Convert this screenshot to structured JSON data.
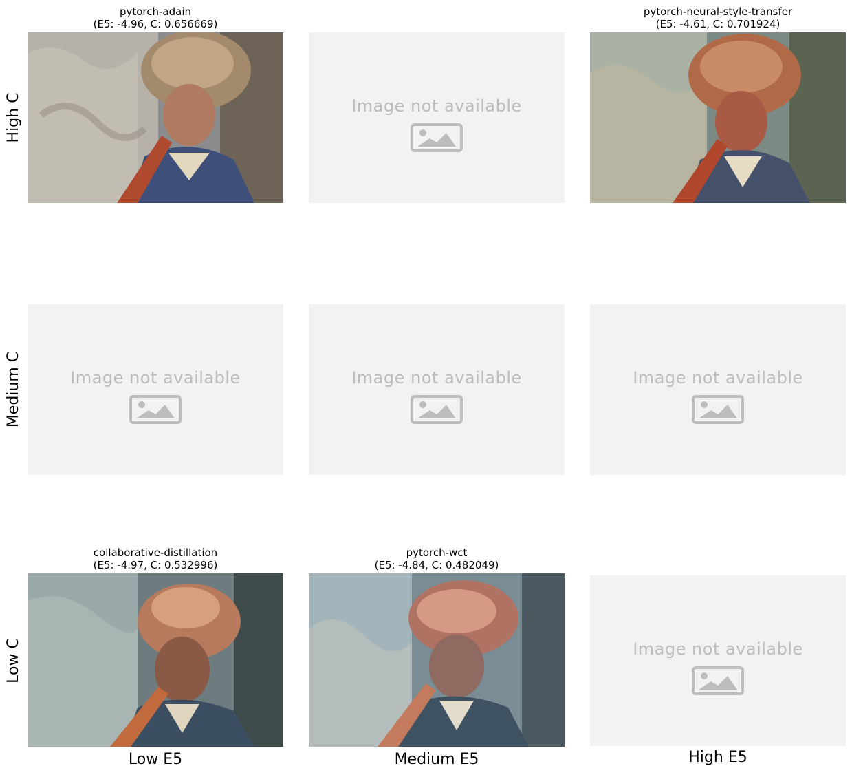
{
  "row_labels": [
    "High C",
    "Medium C",
    "Low C"
  ],
  "col_labels": [
    "Low E5",
    "Medium E5",
    "High E5"
  ],
  "placeholder_text": "Image not available",
  "cells": {
    "r0c0": {
      "title_line1": "pytorch-adain",
      "title_line2": "(E5: -4.96, C: 0.656669)"
    },
    "r0c2": {
      "title_line1": "pytorch-neural-style-transfer",
      "title_line2": "(E5: -4.61, C: 0.701924)"
    },
    "r2c0": {
      "title_line1": "collaborative-distillation",
      "title_line2": "(E5: -4.97, C: 0.532996)"
    },
    "r2c1": {
      "title_line1": "pytorch-wct",
      "title_line2": "(E5: -4.84, C: 0.482049)"
    }
  },
  "icons": {
    "placeholder": "image-icon"
  },
  "colors": {
    "placeholder_bg": "#f2f2f2",
    "placeholder_fg": "#bdbdbd"
  }
}
